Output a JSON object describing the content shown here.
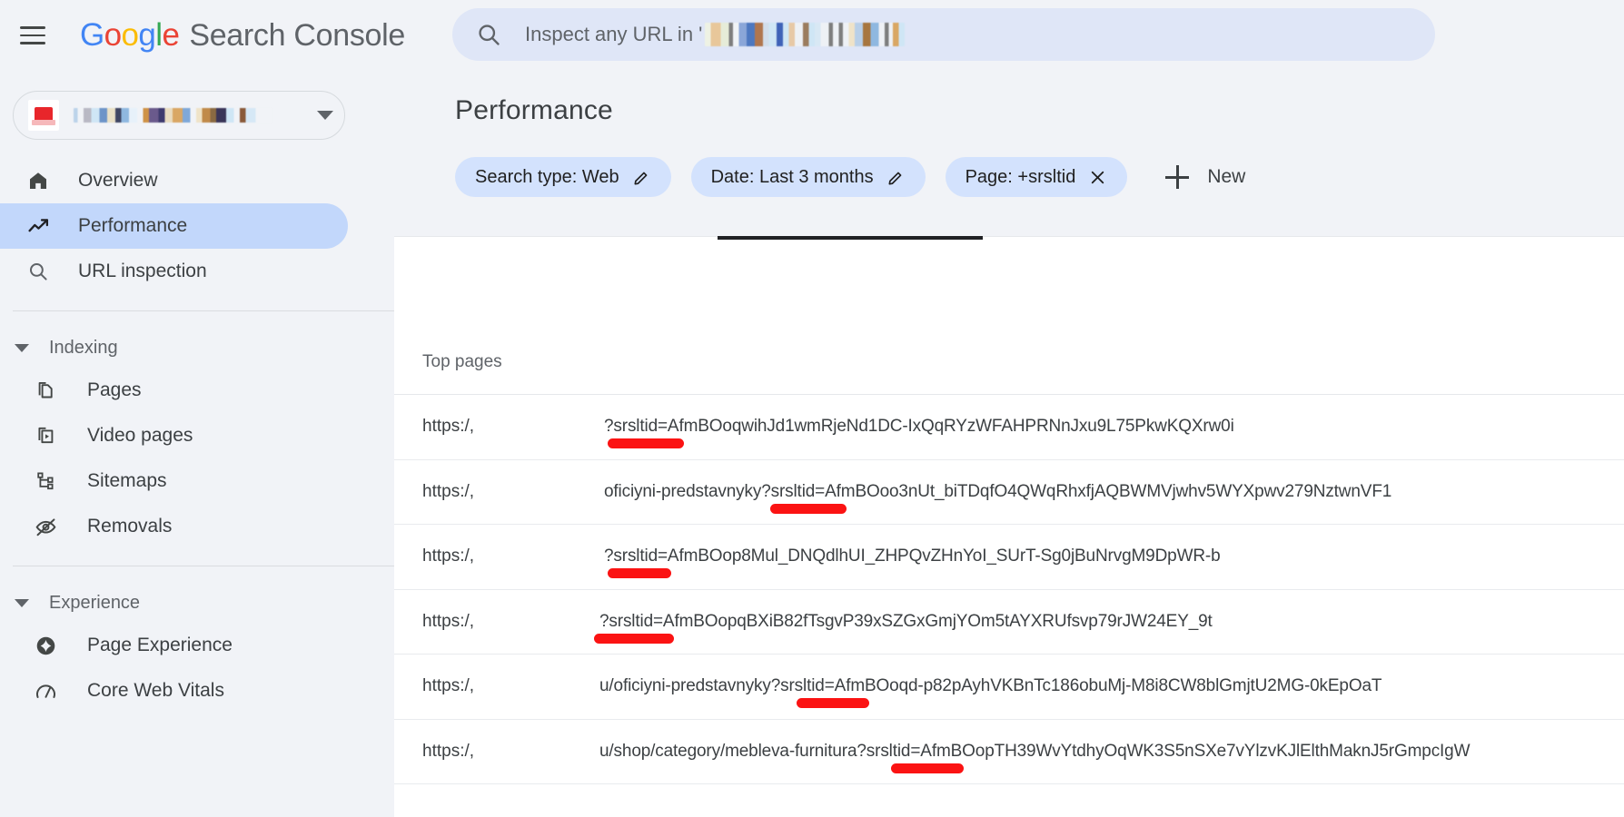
{
  "header": {
    "menu_label": "Main menu",
    "brand_google": "Google",
    "brand_product": "Search Console",
    "search": {
      "prefix": "Inspect any URL in '",
      "redacted_domain": true
    }
  },
  "property_selector": {
    "favicon": "red-site-favicon",
    "redacted_property": true,
    "caret": "chevron-down-icon"
  },
  "sidebar": {
    "items": [
      {
        "id": "overview",
        "label": "Overview",
        "icon": "home-icon",
        "active": false
      },
      {
        "id": "performance",
        "label": "Performance",
        "icon": "trending-up-icon",
        "active": true
      },
      {
        "id": "url-inspection",
        "label": "URL inspection",
        "icon": "search-icon",
        "active": false
      }
    ],
    "sections": [
      {
        "id": "indexing",
        "title": "Indexing",
        "expanded": true,
        "items": [
          {
            "id": "pages",
            "label": "Pages",
            "icon": "pages-copy-icon"
          },
          {
            "id": "video-pages",
            "label": "Video pages",
            "icon": "video-pages-icon"
          },
          {
            "id": "sitemaps",
            "label": "Sitemaps",
            "icon": "sitemap-tree-icon"
          },
          {
            "id": "removals",
            "label": "Removals",
            "icon": "eye-off-icon"
          }
        ]
      },
      {
        "id": "experience",
        "title": "Experience",
        "expanded": true,
        "items": [
          {
            "id": "page-experience",
            "label": "Page Experience",
            "icon": "page-experience-icon"
          },
          {
            "id": "core-web-vitals",
            "label": "Core Web Vitals",
            "icon": "speedometer-icon"
          }
        ]
      }
    ]
  },
  "main": {
    "title": "Performance",
    "filters": [
      {
        "id": "search-type",
        "label": "Search type: Web",
        "action": "edit"
      },
      {
        "id": "date",
        "label": "Date: Last 3 months",
        "action": "edit"
      },
      {
        "id": "page",
        "label": "Page: +srsltid",
        "action": "remove"
      }
    ],
    "new_filter_label": "New",
    "table": {
      "column_header": "Top pages",
      "scheme_prefix": "https:/,",
      "rows": [
        {
          "url": "?srsltid=AfmBOoqwihJd1wmRjeNd1DC-IxQqRYzWFAHPRNnJxu9L75PkwKQXrw0i",
          "highlight_token": "srsltid"
        },
        {
          "url": "oficiyni-predstavnyky?srsltid=AfmBOoo3nUt_biTDqfO4QWqRhxfjAQBWMVjwhv5WYXpwv279NztwnVF1",
          "highlight_token": "srsltid"
        },
        {
          "url": "?srsltid=AfmBOop8Mul_DNQdlhUI_ZHPQvZHnYoI_SUrT-Sg0jBuNrvgM9DpWR-b",
          "highlight_token": "srsltid"
        },
        {
          "url": "?srsltid=AfmBOopqBXiB82fTsgvP39xSZGxGmjYOm5tAYXRUfsvp79rJW24EY_9t",
          "highlight_token": "srsltid"
        },
        {
          "url": "u/oficiyni-predstavnyky?srsltid=AfmBOoqd-p82pAyhVKBnTc186obuMj-M8i8CW8blGmjtU2MG-0kEpOaT",
          "highlight_token": "srsltid"
        },
        {
          "url": "u/shop/category/mebleva-furnitura?srsltid=AfmBOopTH39WvYtdhyOqWK3S5nSXe7vYlzvKJlElthMaknJ5rGmpcIgW",
          "highlight_token": "srsltid"
        }
      ]
    }
  },
  "colors": {
    "page_bg": "#f1f3f7",
    "card_bg": "#ffffff",
    "nav_active_bg": "#c2d7fb",
    "chip_bg": "#d3e2fd",
    "search_bg": "#dfe6f7",
    "text_primary": "#3c4043",
    "text_secondary": "#5f6368",
    "annotation_red": "#fb1313",
    "google_blue": "#4285f4",
    "google_red": "#ea4335",
    "google_yellow": "#fbbc05",
    "google_green": "#34a853"
  }
}
